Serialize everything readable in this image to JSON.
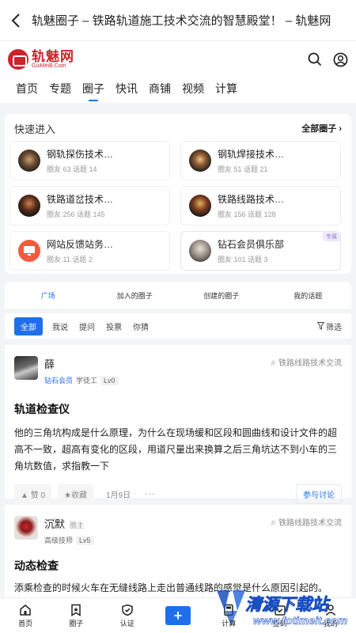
{
  "header": {
    "page_title": "轨魅圈子 – 铁路轨道施工技术交流的智慧殿堂！ – 轨魅网"
  },
  "brand": {
    "logo_main": "轨魅网",
    "logo_sub": "GuiMeiB.Com",
    "accent": "#d0222d"
  },
  "nav": {
    "tabs": [
      "首页",
      "专题",
      "圈子",
      "快讯",
      "商铺",
      "视频",
      "计算"
    ],
    "active_index": 2
  },
  "quick_entry": {
    "title": "快速进入",
    "all_link": "全部圈子",
    "circles": [
      {
        "name": "钢轨探伤技术…",
        "meta": "圈友 63 话题 14"
      },
      {
        "name": "钢轨焊接技术…",
        "meta": "圈友 51 话题 21"
      },
      {
        "name": "铁路道岔技术…",
        "meta": "圈友 256 话题 145"
      },
      {
        "name": "铁路线路技术…",
        "meta": "圈友 156 话题 128"
      },
      {
        "name": "网站反馈站务…",
        "meta": "圈友 11 话题 2"
      },
      {
        "name": "钻石会员俱乐部",
        "meta": "圈友 101 话题 3",
        "badge": "专属"
      }
    ]
  },
  "feed_tabs": [
    "广场",
    "加入的圈子",
    "创建的圈子",
    "我的话题"
  ],
  "filters": {
    "chips": [
      "全部",
      "我说",
      "提问",
      "投票",
      "你猜"
    ],
    "filter_label": "筛选"
  },
  "posts": [
    {
      "user": "薛",
      "role": "",
      "member": "钻石会员",
      "rank": "学徒工",
      "level": "Lv0",
      "circle": "铁路线路技术交流",
      "title": "轨道检查仪",
      "body": "他的三角坑构成是什么原理，为什么在现场缓和区段和圆曲线和设计文件的超高不一致，超高有变化的区段，用道尺量出来换算之后三角坑达不到小车的三角坑数值，求指教一下",
      "like": "赞 0",
      "fav": "收藏",
      "date": "1月9日",
      "more": "···",
      "join": "参与讨论"
    },
    {
      "user": "沉默",
      "role": "圈主",
      "member": "",
      "rank": "高级技师",
      "level": "Lv5",
      "circle": "铁路线路技术交流",
      "title": "动态检查",
      "body": "添乘检查的时候火车在无缝线路上走出普通线路的感觉是什么原因引起的。"
    }
  ],
  "bottom_nav": [
    "首页",
    "圈子",
    "认证",
    "+",
    "计算",
    "签到",
    "我的"
  ],
  "watermark": {
    "text": "清源下载站",
    "url": "www.fotimeit.com"
  }
}
